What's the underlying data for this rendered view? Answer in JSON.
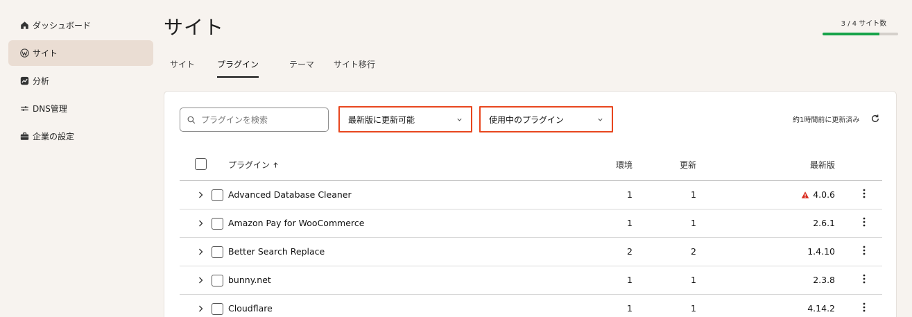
{
  "sidebar": {
    "items": [
      {
        "label": "ダッシュボード",
        "icon": "home-icon"
      },
      {
        "label": "サイト",
        "icon": "wordpress-icon",
        "active": true
      },
      {
        "label": "分析",
        "icon": "analytics-icon"
      },
      {
        "label": "DNS管理",
        "icon": "dns-icon"
      },
      {
        "label": "企業の設定",
        "icon": "briefcase-icon"
      }
    ]
  },
  "header": {
    "title": "サイト",
    "quota_label": "3 / 4 サイト数",
    "quota_used": 3,
    "quota_total": 4
  },
  "tabs": [
    {
      "label": "サイト"
    },
    {
      "label": "プラグイン",
      "active": true
    },
    {
      "label": "テーマ"
    },
    {
      "label": "サイト移行"
    }
  ],
  "toolbar": {
    "search_placeholder": "プラグインを検索",
    "filter_update": "最新版に更新可能",
    "filter_status": "使用中のプラグイン",
    "updated_text": "約1時間前に更新済み"
  },
  "table": {
    "headers": {
      "plugin": "プラグイン",
      "env": "環境",
      "updates": "更新",
      "latest": "最新版"
    },
    "rows": [
      {
        "name": "Advanced Database Cleaner",
        "env": "1",
        "updates": "1",
        "latest": "4.0.6",
        "warning": true
      },
      {
        "name": "Amazon Pay for WooCommerce",
        "env": "1",
        "updates": "1",
        "latest": "2.6.1",
        "warning": false
      },
      {
        "name": "Better Search Replace",
        "env": "2",
        "updates": "2",
        "latest": "1.4.10",
        "warning": false
      },
      {
        "name": "bunny.net",
        "env": "1",
        "updates": "1",
        "latest": "2.3.8",
        "warning": false
      },
      {
        "name": "Cloudflare",
        "env": "1",
        "updates": "1",
        "latest": "4.14.2",
        "warning": false
      }
    ]
  },
  "colors": {
    "accent_outline": "#e8461e",
    "progress": "#17a34a",
    "warning": "#d92d20",
    "sidebar_active": "#eaddd3"
  }
}
